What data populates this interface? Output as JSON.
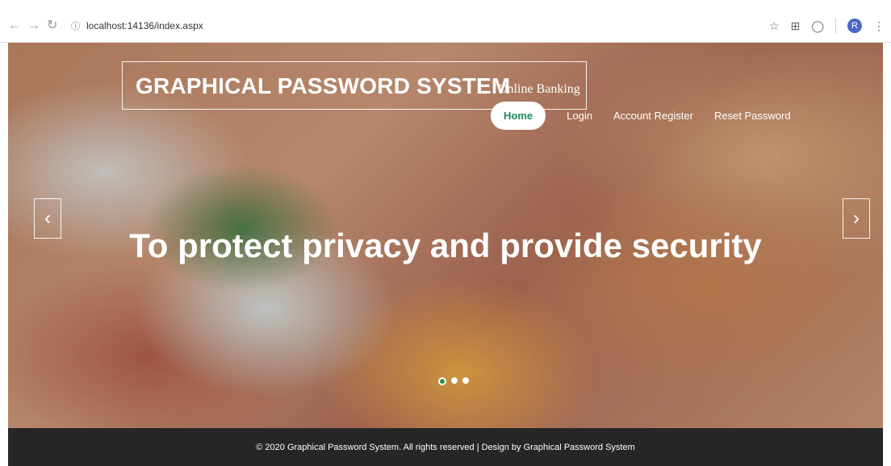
{
  "browser": {
    "url": "localhost:14136/index.aspx",
    "back_icon": "back-arrow-icon",
    "forward_icon": "forward-arrow-icon",
    "reload_icon": "reload-icon",
    "profile_initial": "R"
  },
  "site": {
    "brand_title": "GRAPHICAL PASSWORD SYSTEM",
    "brand_subtitle": "Online Banking",
    "nav": [
      "Home",
      "Login",
      "Account Register",
      "Reset Password"
    ],
    "active_nav": "Home",
    "hero_heading": "To protect privacy and provide security",
    "slide_count": 3,
    "active_slide": 1
  },
  "footer": {
    "text": "© 2020 Graphical Password System. All rights reserved | Design by Graphical Password System"
  },
  "colors": {
    "footer_bg": "#262626",
    "accent": "#1d8a5a",
    "profile": "#4a67c8"
  }
}
